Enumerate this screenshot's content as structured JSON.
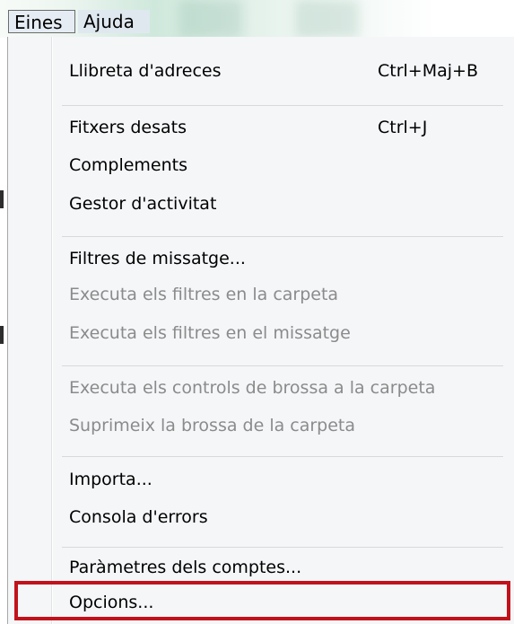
{
  "menubar": {
    "items": [
      {
        "label": "Eines"
      },
      {
        "label": "Ajuda"
      }
    ]
  },
  "menu": {
    "items": [
      {
        "label": "Llibreta d'adreces",
        "shortcut": "Ctrl+Maj+B",
        "enabled": true
      },
      {
        "label": "Fitxers desats",
        "shortcut": "Ctrl+J",
        "enabled": true
      },
      {
        "label": "Complements",
        "enabled": true
      },
      {
        "label": "Gestor d'activitat",
        "enabled": true
      },
      {
        "label": "Filtres de missatge...",
        "enabled": true
      },
      {
        "label": "Executa els filtres en la carpeta",
        "enabled": false
      },
      {
        "label": "Executa els filtres en el missatge",
        "enabled": false
      },
      {
        "label": "Executa els controls de brossa a la carpeta",
        "enabled": false
      },
      {
        "label": "Suprimeix la brossa de la carpeta",
        "enabled": false
      },
      {
        "label": "Importa...",
        "enabled": true
      },
      {
        "label": "Consola d'errors",
        "enabled": true
      },
      {
        "label": "Paràmetres dels comptes...",
        "enabled": true
      },
      {
        "label": "Opcions...",
        "enabled": true,
        "highlighted": true
      }
    ]
  },
  "colors": {
    "highlight_border": "#c1121b",
    "disabled_text": "#8b8b8b",
    "menu_bg": "#f4f6f8"
  }
}
